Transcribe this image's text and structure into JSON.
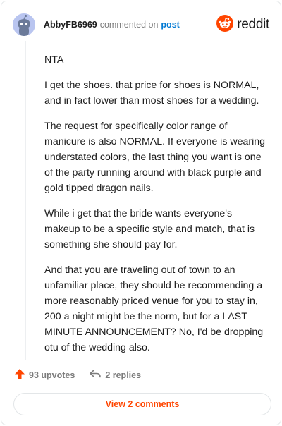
{
  "comment": {
    "author": "AbbyFB6969",
    "action": "commented on",
    "post_link": "post",
    "brand": "reddit",
    "paragraphs": [
      "NTA",
      "I get the shoes. that price for shoes is NORMAL, and in fact lower than most shoes for a wedding.",
      "The request for specifically color range of manicure is also NORMAL. If everyone is wearing understated colors, the last thing you want is one of the party running around with black purple and gold tipped dragon nails.",
      "While i get that the bride wants everyone's makeup to be a specific style and match, that is something she should pay for.",
      "And that you are traveling out of town to an unfamiliar place, they should be recommending a more reasonably priced venue for you to stay in, 200 a night might be the norm, but for a LAST MINUTE ANNOUNCEMENT? No, I'd be dropping otu of the wedding also."
    ]
  },
  "footer": {
    "upvotes": "93 upvotes",
    "replies": "2 replies",
    "view_comments": "View 2 comments"
  },
  "colors": {
    "brand_orange": "#ff4500",
    "link_blue": "#0079d3",
    "avatar_bg": "#b9c5f0"
  },
  "icons": {
    "avatar": "snoo-avatar-icon",
    "logo": "reddit-logo-icon",
    "upvote": "upvote-arrow-icon",
    "reply": "reply-arrow-icon"
  }
}
